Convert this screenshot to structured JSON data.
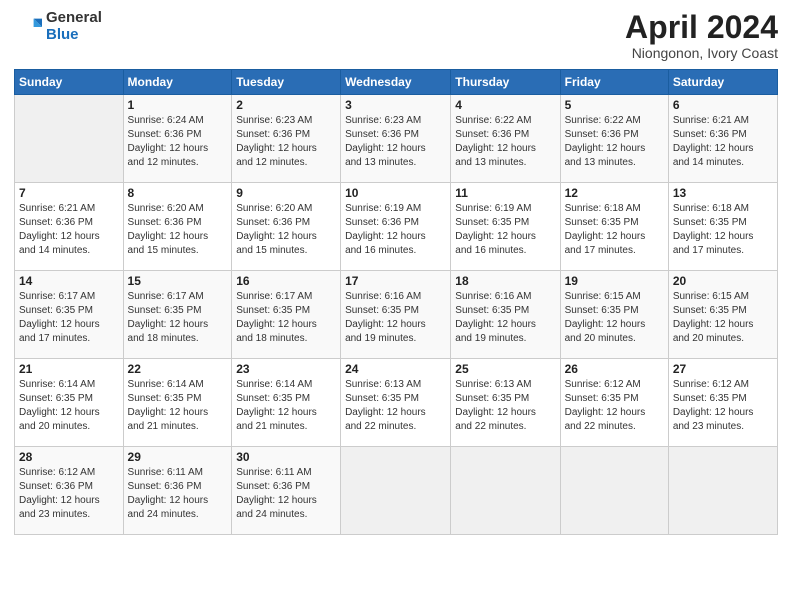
{
  "header": {
    "logo_general": "General",
    "logo_blue": "Blue",
    "month_title": "April 2024",
    "subtitle": "Niongonon, Ivory Coast"
  },
  "weekdays": [
    "Sunday",
    "Monday",
    "Tuesday",
    "Wednesday",
    "Thursday",
    "Friday",
    "Saturday"
  ],
  "weeks": [
    [
      {
        "day": "",
        "info": ""
      },
      {
        "day": "1",
        "info": "Sunrise: 6:24 AM\nSunset: 6:36 PM\nDaylight: 12 hours\nand 12 minutes."
      },
      {
        "day": "2",
        "info": "Sunrise: 6:23 AM\nSunset: 6:36 PM\nDaylight: 12 hours\nand 12 minutes."
      },
      {
        "day": "3",
        "info": "Sunrise: 6:23 AM\nSunset: 6:36 PM\nDaylight: 12 hours\nand 13 minutes."
      },
      {
        "day": "4",
        "info": "Sunrise: 6:22 AM\nSunset: 6:36 PM\nDaylight: 12 hours\nand 13 minutes."
      },
      {
        "day": "5",
        "info": "Sunrise: 6:22 AM\nSunset: 6:36 PM\nDaylight: 12 hours\nand 13 minutes."
      },
      {
        "day": "6",
        "info": "Sunrise: 6:21 AM\nSunset: 6:36 PM\nDaylight: 12 hours\nand 14 minutes."
      }
    ],
    [
      {
        "day": "7",
        "info": "Sunrise: 6:21 AM\nSunset: 6:36 PM\nDaylight: 12 hours\nand 14 minutes."
      },
      {
        "day": "8",
        "info": "Sunrise: 6:20 AM\nSunset: 6:36 PM\nDaylight: 12 hours\nand 15 minutes."
      },
      {
        "day": "9",
        "info": "Sunrise: 6:20 AM\nSunset: 6:36 PM\nDaylight: 12 hours\nand 15 minutes."
      },
      {
        "day": "10",
        "info": "Sunrise: 6:19 AM\nSunset: 6:36 PM\nDaylight: 12 hours\nand 16 minutes."
      },
      {
        "day": "11",
        "info": "Sunrise: 6:19 AM\nSunset: 6:35 PM\nDaylight: 12 hours\nand 16 minutes."
      },
      {
        "day": "12",
        "info": "Sunrise: 6:18 AM\nSunset: 6:35 PM\nDaylight: 12 hours\nand 17 minutes."
      },
      {
        "day": "13",
        "info": "Sunrise: 6:18 AM\nSunset: 6:35 PM\nDaylight: 12 hours\nand 17 minutes."
      }
    ],
    [
      {
        "day": "14",
        "info": "Sunrise: 6:17 AM\nSunset: 6:35 PM\nDaylight: 12 hours\nand 17 minutes."
      },
      {
        "day": "15",
        "info": "Sunrise: 6:17 AM\nSunset: 6:35 PM\nDaylight: 12 hours\nand 18 minutes."
      },
      {
        "day": "16",
        "info": "Sunrise: 6:17 AM\nSunset: 6:35 PM\nDaylight: 12 hours\nand 18 minutes."
      },
      {
        "day": "17",
        "info": "Sunrise: 6:16 AM\nSunset: 6:35 PM\nDaylight: 12 hours\nand 19 minutes."
      },
      {
        "day": "18",
        "info": "Sunrise: 6:16 AM\nSunset: 6:35 PM\nDaylight: 12 hours\nand 19 minutes."
      },
      {
        "day": "19",
        "info": "Sunrise: 6:15 AM\nSunset: 6:35 PM\nDaylight: 12 hours\nand 20 minutes."
      },
      {
        "day": "20",
        "info": "Sunrise: 6:15 AM\nSunset: 6:35 PM\nDaylight: 12 hours\nand 20 minutes."
      }
    ],
    [
      {
        "day": "21",
        "info": "Sunrise: 6:14 AM\nSunset: 6:35 PM\nDaylight: 12 hours\nand 20 minutes."
      },
      {
        "day": "22",
        "info": "Sunrise: 6:14 AM\nSunset: 6:35 PM\nDaylight: 12 hours\nand 21 minutes."
      },
      {
        "day": "23",
        "info": "Sunrise: 6:14 AM\nSunset: 6:35 PM\nDaylight: 12 hours\nand 21 minutes."
      },
      {
        "day": "24",
        "info": "Sunrise: 6:13 AM\nSunset: 6:35 PM\nDaylight: 12 hours\nand 22 minutes."
      },
      {
        "day": "25",
        "info": "Sunrise: 6:13 AM\nSunset: 6:35 PM\nDaylight: 12 hours\nand 22 minutes."
      },
      {
        "day": "26",
        "info": "Sunrise: 6:12 AM\nSunset: 6:35 PM\nDaylight: 12 hours\nand 22 minutes."
      },
      {
        "day": "27",
        "info": "Sunrise: 6:12 AM\nSunset: 6:35 PM\nDaylight: 12 hours\nand 23 minutes."
      }
    ],
    [
      {
        "day": "28",
        "info": "Sunrise: 6:12 AM\nSunset: 6:36 PM\nDaylight: 12 hours\nand 23 minutes."
      },
      {
        "day": "29",
        "info": "Sunrise: 6:11 AM\nSunset: 6:36 PM\nDaylight: 12 hours\nand 24 minutes."
      },
      {
        "day": "30",
        "info": "Sunrise: 6:11 AM\nSunset: 6:36 PM\nDaylight: 12 hours\nand 24 minutes."
      },
      {
        "day": "",
        "info": ""
      },
      {
        "day": "",
        "info": ""
      },
      {
        "day": "",
        "info": ""
      },
      {
        "day": "",
        "info": ""
      }
    ]
  ]
}
